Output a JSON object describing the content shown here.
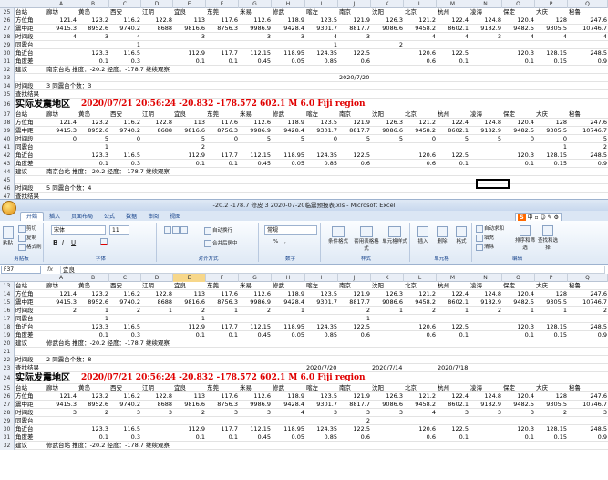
{
  "window": {
    "title": "-20.2 -178.7 修皮 3 2020-07-20临震预报表.xls - Microsoft Excel"
  },
  "ribbon": {
    "tabs": [
      "开始",
      "插入",
      "页面布局",
      "公式",
      "数据",
      "审阅",
      "视图"
    ],
    "active_tab": "开始",
    "clipboard": {
      "paste": "粘贴",
      "cut": "剪切",
      "copy": "复制",
      "painter": "格式刷",
      "label": "剪贴板"
    },
    "font": {
      "name": "宋体",
      "size": "11",
      "label": "字体",
      "bold": "B",
      "italic": "I",
      "underline": "U"
    },
    "alignment": {
      "wrap": "自动换行",
      "merge": "合并后居中",
      "label": "对齐方式"
    },
    "number": {
      "format": "常规",
      "label": "数字",
      "pct": "%",
      "comma": ","
    },
    "styles": {
      "cond": "条件格式",
      "table": "套用表格格式",
      "cell": "单元格样式",
      "label": "样式"
    },
    "cells": {
      "insert": "插入",
      "delete": "删除",
      "format": "格式",
      "label": "单元格"
    },
    "editing": {
      "autosum": "自动求和",
      "fill": "填充",
      "clear": "清除",
      "sort": "排序和筛选",
      "find": "查找和选择",
      "label": "编辑"
    },
    "ime": {
      "logo": "S",
      "text": "中 ▫ ☺ ✎ ⚙"
    }
  },
  "formula_bar": {
    "name_box": "F37",
    "fx": "fx",
    "value": "宜良"
  },
  "columns": [
    "A",
    "B",
    "C",
    "D",
    "E",
    "F",
    "G",
    "H",
    "I",
    "J",
    "K",
    "L",
    "M",
    "N",
    "O",
    "P",
    "Q"
  ],
  "top_sheet": {
    "rows": [
      {
        "n": "25",
        "cells": [
          "台站",
          "廊坊",
          "黄岛",
          "西安",
          "江阴",
          "宜良",
          "东莞",
          "米易",
          "修武",
          "喀左",
          "南京",
          "沈阳",
          "北京",
          "杭州",
          "凌海",
          "保定",
          "大庆",
          "秘鲁"
        ]
      },
      {
        "n": "26",
        "cells": [
          "方位角",
          "121.4",
          "123.2",
          "116.2",
          "122.8",
          "113",
          "117.6",
          "112.6",
          "118.9",
          "123.5",
          "121.9",
          "126.3",
          "121.2",
          "122.4",
          "124.8",
          "120.4",
          "128",
          "247.6"
        ]
      },
      {
        "n": "27",
        "cells": [
          "震中距",
          "9415.3",
          "8952.6",
          "9740.2",
          "8688",
          "9816.6",
          "8756.3",
          "9986.9",
          "9428.4",
          "9301.7",
          "8817.7",
          "9086.6",
          "9458.2",
          "8602.1",
          "9182.9",
          "9482.5",
          "9305.5",
          "10746.7"
        ]
      },
      {
        "n": "28",
        "cells": [
          "时间段",
          "4",
          "3",
          "4",
          "",
          "3",
          "",
          "3",
          "3",
          "4",
          "3",
          "",
          "4",
          "4",
          "3",
          "4",
          "4",
          "4"
        ]
      },
      {
        "n": "29",
        "cells": [
          "同震台",
          "",
          "",
          "1",
          "",
          "",
          "",
          "",
          "",
          "1",
          "",
          "2",
          "",
          "",
          "",
          "",
          "",
          ""
        ]
      },
      {
        "n": "30",
        "cells": [
          "角近台",
          "",
          "123.3",
          "116.5",
          "",
          "112.9",
          "117.7",
          "112.15",
          "118.95",
          "124.35",
          "122.5",
          "",
          "120.6",
          "122.5",
          "",
          "120.3",
          "128.15",
          "248.5"
        ]
      },
      {
        "n": "31",
        "cells": [
          "角度差",
          "",
          "0.1",
          "0.3",
          "",
          "0.1",
          "0.1",
          "0.45",
          "0.05",
          "0.85",
          "0.6",
          "",
          "0.6",
          "0.1",
          "",
          "0.1",
          "0.15",
          "0.9"
        ]
      },
      {
        "n": "32",
        "cells": [
          "建议",
          "南京台站 推度：-20.2 经度：-178.7 继续观察",
          "",
          "",
          "",
          "",
          "",
          "",
          "",
          "",
          "",
          "",
          "",
          "",
          "",
          "",
          "",
          ""
        ]
      },
      {
        "n": "33",
        "cells": [
          "",
          "",
          "",
          "",
          "",
          "",
          "",
          "",
          "",
          "",
          "2020/7/20",
          "",
          "",
          "",
          "",
          "",
          "",
          ""
        ]
      },
      {
        "n": "34",
        "cells": [
          "时间段",
          "3  同震台个数：3",
          "",
          "",
          "",
          "",
          "",
          "",
          "",
          "",
          "",
          "",
          "",
          "",
          "",
          "",
          "",
          ""
        ]
      },
      {
        "n": "35",
        "cells": [
          "查找结果",
          "",
          "",
          "",
          "",
          "",
          "",
          "",
          "",
          "",
          "",
          "",
          "",
          "",
          "",
          "",
          "",
          ""
        ]
      }
    ],
    "quake": {
      "n": "36",
      "label": "实际发震地区",
      "info": "2020/07/21 20:56:24 -20.832 -178.572 602.1 M 6.0 Fiji region"
    },
    "rows2": [
      {
        "n": "37",
        "cells": [
          "台站",
          "廊坊",
          "黄岛",
          "西安",
          "江阴",
          "宜良",
          "东莞",
          "米易",
          "修武",
          "喀左",
          "南京",
          "沈阳",
          "北京",
          "杭州",
          "凌海",
          "保定",
          "大庆",
          "秘鲁"
        ]
      },
      {
        "n": "38",
        "cells": [
          "方位角",
          "121.4",
          "123.2",
          "116.2",
          "122.8",
          "113",
          "117.6",
          "112.6",
          "118.9",
          "123.5",
          "121.9",
          "126.3",
          "121.2",
          "122.4",
          "124.8",
          "120.4",
          "128",
          "247.6"
        ]
      },
      {
        "n": "39",
        "cells": [
          "震中距",
          "9415.3",
          "8952.6",
          "9740.2",
          "8688",
          "9816.6",
          "8756.3",
          "9986.9",
          "9428.4",
          "9301.7",
          "8817.7",
          "9086.6",
          "9458.2",
          "8602.1",
          "9182.9",
          "9482.5",
          "9305.5",
          "10746.7"
        ]
      },
      {
        "n": "40",
        "cells": [
          "时间段",
          "0",
          "5",
          "0",
          "",
          "5",
          "0",
          "5",
          "5",
          "0",
          "5",
          "5",
          "0",
          "5",
          "5",
          "0",
          "0",
          "5"
        ]
      },
      {
        "n": "41",
        "cells": [
          "同震台",
          "",
          "1",
          "",
          "",
          "2",
          "",
          "",
          "",
          "",
          "",
          "",
          "",
          "",
          "",
          "",
          "1",
          "2"
        ]
      },
      {
        "n": "42",
        "cells": [
          "角近台",
          "",
          "123.3",
          "116.5",
          "",
          "112.9",
          "117.7",
          "112.15",
          "118.95",
          "124.35",
          "122.5",
          "",
          "120.6",
          "122.5",
          "",
          "120.3",
          "128.15",
          "248.5"
        ]
      },
      {
        "n": "43",
        "cells": [
          "角度差",
          "",
          "0.1",
          "0.3",
          "",
          "0.1",
          "0.1",
          "0.45",
          "0.05",
          "0.85",
          "0.6",
          "",
          "0.6",
          "0.1",
          "",
          "0.1",
          "0.15",
          "0.9"
        ]
      },
      {
        "n": "44",
        "cells": [
          "建议",
          "南京台站 推度：-20.2 经度：-178.7 继续观察",
          "",
          "",
          "",
          "",
          "",
          "",
          "",
          "",
          "",
          "",
          "",
          "",
          "",
          "",
          "",
          ""
        ]
      },
      {
        "n": "45",
        "cells": [
          "",
          "",
          "",
          "",
          "",
          "",
          "",
          "",
          "",
          "",
          "",
          "",
          "",
          "",
          "",
          "",
          "",
          ""
        ]
      },
      {
        "n": "46",
        "cells": [
          "时间段",
          "5  同震台个数：4",
          "",
          "",
          "",
          "",
          "",
          "",
          "",
          "",
          "",
          "",
          "",
          "",
          "",
          "",
          "",
          ""
        ]
      },
      {
        "n": "47",
        "cells": [
          "查找结果",
          "",
          "",
          "",
          "",
          "",
          "",
          "",
          "",
          "",
          "",
          "",
          "",
          "",
          "",
          "",
          "",
          ""
        ]
      }
    ]
  },
  "bottom_sheet": {
    "rows": [
      {
        "n": "13",
        "cells": [
          "台站",
          "廊坊",
          "黄岛",
          "西安",
          "江阴",
          "宜良",
          "东莞",
          "米易",
          "修武",
          "喀左",
          "南京",
          "沈阳",
          "北京",
          "杭州",
          "凌海",
          "保定",
          "大庆",
          "秘鲁"
        ]
      },
      {
        "n": "14",
        "cells": [
          "方位角",
          "121.4",
          "123.2",
          "116.2",
          "122.8",
          "113",
          "117.6",
          "112.6",
          "118.9",
          "123.5",
          "121.9",
          "126.3",
          "121.2",
          "122.4",
          "124.8",
          "120.4",
          "128",
          "247.6"
        ]
      },
      {
        "n": "15",
        "cells": [
          "震中距",
          "9415.3",
          "8952.6",
          "9740.2",
          "8688",
          "9816.6",
          "8756.3",
          "9986.9",
          "9428.4",
          "9301.7",
          "8817.7",
          "9086.6",
          "9458.2",
          "8602.1",
          "9182.9",
          "9482.5",
          "9305.5",
          "10746.7"
        ]
      },
      {
        "n": "16",
        "cells": [
          "时间段",
          "2",
          "1",
          "2",
          "1",
          "2",
          "1",
          "2",
          "1",
          "",
          "2",
          "1",
          "2",
          "1",
          "2",
          "1",
          "1",
          "2"
        ]
      },
      {
        "n": "17",
        "cells": [
          "同震台",
          "",
          "1",
          "",
          "",
          "1",
          "",
          "",
          "",
          "",
          "1",
          "",
          "",
          "",
          "",
          "",
          "",
          ""
        ]
      },
      {
        "n": "18",
        "cells": [
          "角近台",
          "",
          "123.3",
          "116.5",
          "",
          "112.9",
          "117.7",
          "112.15",
          "118.95",
          "124.35",
          "122.5",
          "",
          "120.6",
          "122.5",
          "",
          "120.3",
          "128.15",
          "248.5"
        ]
      },
      {
        "n": "19",
        "cells": [
          "角度差",
          "",
          "0.1",
          "0.3",
          "",
          "0.1",
          "0.1",
          "0.45",
          "0.05",
          "0.85",
          "0.6",
          "",
          "0.6",
          "0.1",
          "",
          "0.1",
          "0.15",
          "0.9"
        ]
      },
      {
        "n": "20",
        "cells": [
          "建议",
          "修武台站 推度：-20.2 经度：-178.7 继续观察",
          "",
          "",
          "",
          "",
          "",
          "",
          "",
          "",
          "",
          "",
          "",
          "",
          "",
          "",
          "",
          ""
        ]
      },
      {
        "n": "21",
        "cells": [
          "",
          "",
          "",
          "",
          "",
          "",
          "",
          "",
          "",
          "",
          "",
          "",
          "",
          "",
          "",
          "",
          "",
          ""
        ]
      },
      {
        "n": "22",
        "cells": [
          "时间段",
          "2  同震台个数：8",
          "",
          "",
          "",
          "",
          "",
          "",
          "",
          "",
          "",
          "",
          "",
          "",
          "",
          "",
          "",
          ""
        ]
      },
      {
        "n": "23",
        "cells": [
          "查找结果",
          "",
          "",
          "",
          "",
          "",
          "",
          "",
          "",
          "2020/7/20",
          "",
          "2020/7/14",
          "",
          "2020/7/18",
          "",
          "",
          "",
          ""
        ]
      }
    ],
    "quake": {
      "n": "24",
      "label": "实际发震地区",
      "info": "2020/07/21 20:56:24 -20.832 -178.572 602.1 M 6.0 Fiji region"
    },
    "rows2": [
      {
        "n": "25",
        "cells": [
          "台站",
          "廊坊",
          "黄岛",
          "西安",
          "江阴",
          "宜良",
          "东莞",
          "米易",
          "修武",
          "喀左",
          "南京",
          "沈阳",
          "北京",
          "杭州",
          "凌海",
          "保定",
          "大庆",
          "秘鲁"
        ]
      },
      {
        "n": "26",
        "cells": [
          "方位角",
          "121.4",
          "123.2",
          "116.2",
          "122.8",
          "113",
          "117.6",
          "112.6",
          "118.9",
          "123.5",
          "121.9",
          "126.3",
          "121.2",
          "122.4",
          "124.8",
          "120.4",
          "128",
          "247.6"
        ]
      },
      {
        "n": "27",
        "cells": [
          "震中距",
          "9415.3",
          "8952.6",
          "9740.2",
          "8688",
          "9816.6",
          "8756.3",
          "9986.9",
          "9428.4",
          "9301.7",
          "8817.7",
          "9086.6",
          "9458.2",
          "8602.1",
          "9182.9",
          "9482.5",
          "9305.5",
          "10746.7"
        ]
      },
      {
        "n": "28",
        "cells": [
          "时间段",
          "3",
          "2",
          "3",
          "3",
          "2",
          "3",
          "3",
          "4",
          "3",
          "3",
          "3",
          "4",
          "3",
          "3",
          "3",
          "2",
          "3"
        ]
      },
      {
        "n": "29",
        "cells": [
          "同震台",
          "",
          "",
          "",
          "",
          "",
          "",
          "",
          "",
          "",
          "2",
          "",
          "",
          "",
          "",
          "",
          "",
          ""
        ]
      },
      {
        "n": "30",
        "cells": [
          "角近台",
          "",
          "123.3",
          "116.5",
          "",
          "112.9",
          "117.7",
          "112.15",
          "118.95",
          "124.35",
          "122.5",
          "",
          "120.6",
          "122.5",
          "",
          "120.3",
          "128.15",
          "248.5"
        ]
      },
      {
        "n": "31",
        "cells": [
          "角度差",
          "",
          "0.1",
          "0.3",
          "",
          "0.1",
          "0.1",
          "0.45",
          "0.05",
          "0.85",
          "0.6",
          "",
          "0.6",
          "0.1",
          "",
          "0.1",
          "0.15",
          "0.9"
        ]
      },
      {
        "n": "32",
        "cells": [
          "建议",
          "修武台站 推度：-20.2 经度：-178.7 继续观察",
          "",
          "",
          "",
          "",
          "",
          "",
          "",
          "",
          "",
          "",
          "",
          "",
          "",
          "",
          "",
          ""
        ]
      }
    ]
  }
}
